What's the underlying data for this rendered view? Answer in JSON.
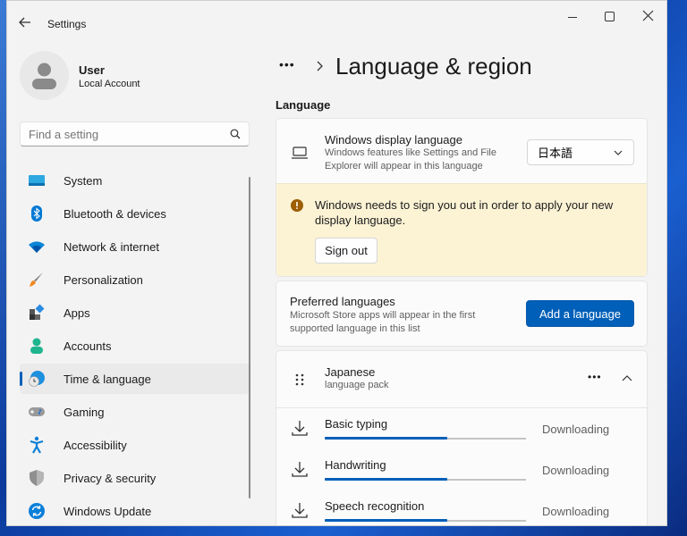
{
  "window": {
    "title": "Settings"
  },
  "user": {
    "name": "User",
    "account_type": "Local Account"
  },
  "search": {
    "placeholder": "Find a setting"
  },
  "sidebar": {
    "items": [
      {
        "label": "System",
        "icon": "system-icon"
      },
      {
        "label": "Bluetooth & devices",
        "icon": "bluetooth-icon"
      },
      {
        "label": "Network & internet",
        "icon": "wifi-icon"
      },
      {
        "label": "Personalization",
        "icon": "brush-icon"
      },
      {
        "label": "Apps",
        "icon": "apps-icon"
      },
      {
        "label": "Accounts",
        "icon": "accounts-icon"
      },
      {
        "label": "Time & language",
        "icon": "time-language-icon",
        "selected": true
      },
      {
        "label": "Gaming",
        "icon": "gamepad-icon"
      },
      {
        "label": "Accessibility",
        "icon": "accessibility-icon"
      },
      {
        "label": "Privacy & security",
        "icon": "shield-icon"
      },
      {
        "label": "Windows Update",
        "icon": "update-icon"
      }
    ]
  },
  "header": {
    "breadcrumb_more": "•••",
    "title": "Language & region"
  },
  "language_section": {
    "label": "Language",
    "display_language": {
      "title": "Windows display language",
      "description_line1": "Windows features like Settings and File",
      "description_line2": "Explorer will appear in this language",
      "selected": "日本語"
    },
    "warning": {
      "line1": "Windows needs to sign you out in order to apply your new",
      "line2": "display language.",
      "button": "Sign out"
    },
    "preferred": {
      "title": "Preferred languages",
      "description_line1": "Microsoft Store apps will appear in the first",
      "description_line2": "supported language in this list",
      "button": "Add a language"
    },
    "language": {
      "name": "Japanese",
      "detail": "language pack",
      "features": [
        {
          "name": "Basic typing",
          "status": "Downloading",
          "progress": 0.61
        },
        {
          "name": "Handwriting",
          "status": "Downloading",
          "progress": 0.61
        },
        {
          "name": "Speech recognition",
          "status": "Downloading",
          "progress": 0.61
        }
      ]
    }
  },
  "colors": {
    "accent": "#005fb8",
    "warning_bg": "#fcf3d5",
    "warning_icon": "#9d5d00"
  }
}
